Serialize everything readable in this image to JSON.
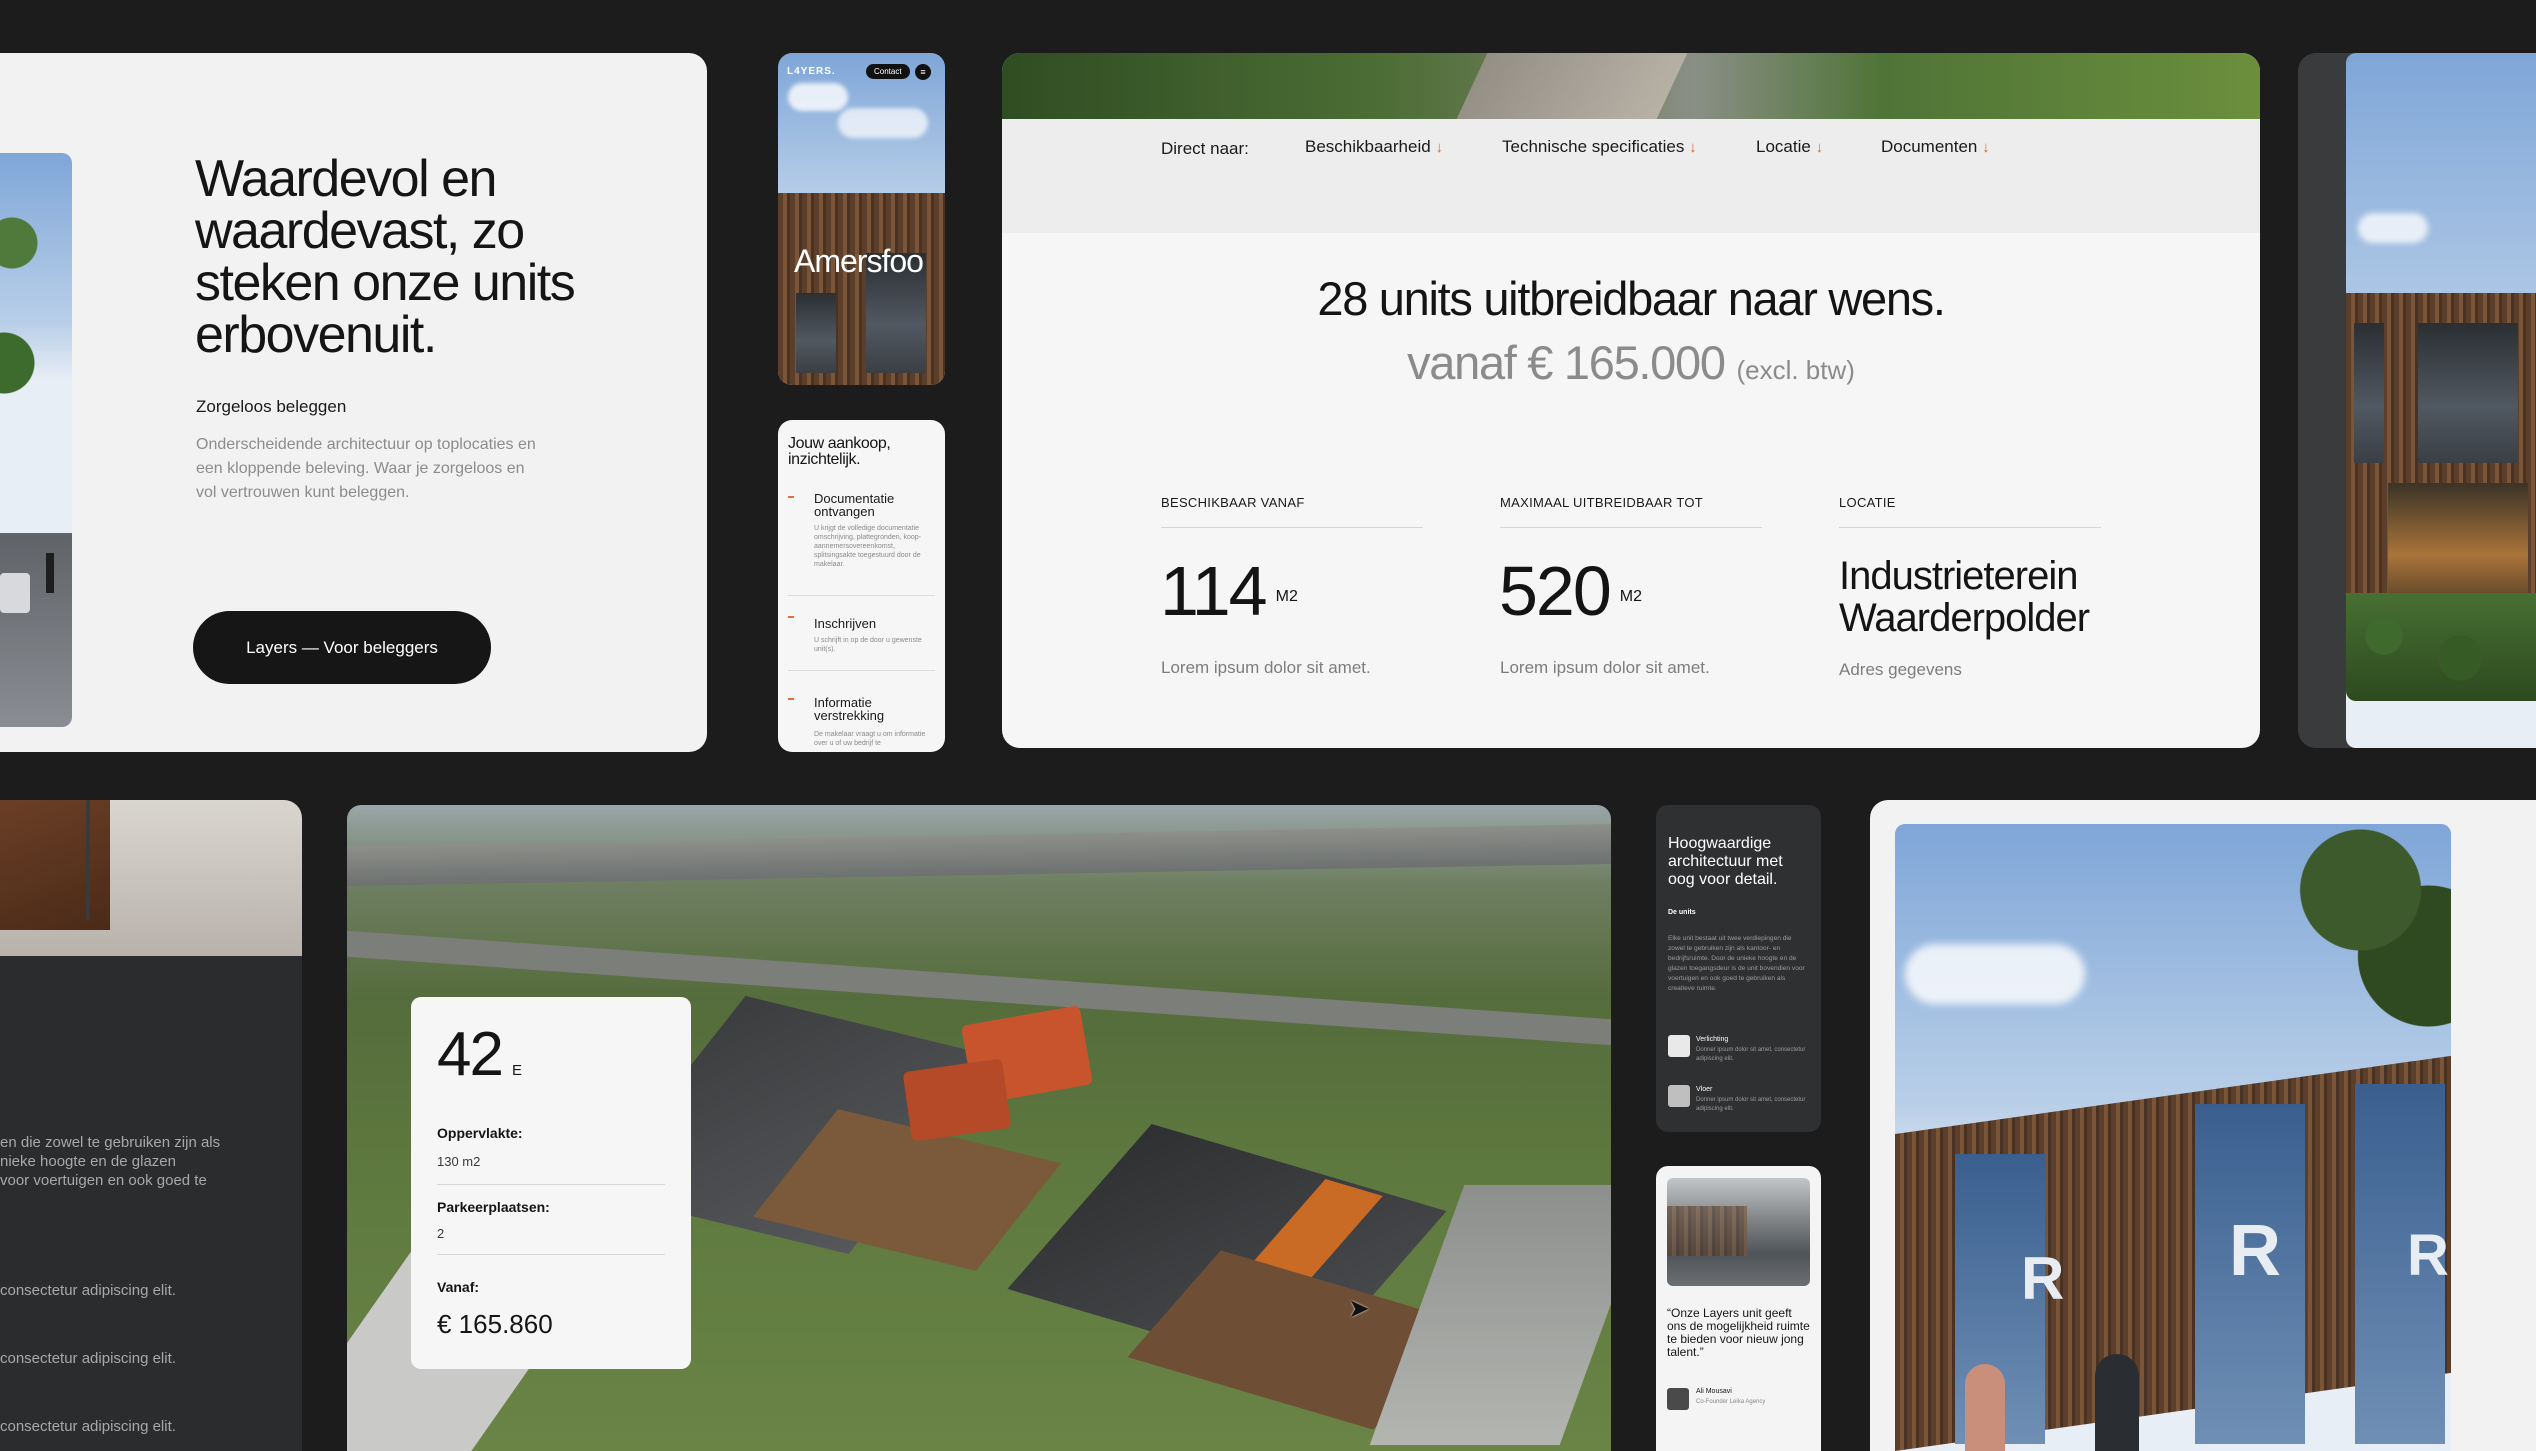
{
  "hero": {
    "title": "Waardevol en waardevast, zo steken onze units erbovenuit.",
    "subtitle": "Zorgeloos beleggen",
    "body": "Onderscheidende architectuur op toplocaties en een kloppende beleving. Waar je zorgeloos en vol vertrouwen kunt beleggen.",
    "button": "Layers — Voor beleggers"
  },
  "mobile_hero": {
    "logo": "L4YERS.",
    "contact": "Contact",
    "city": "Amersfoo"
  },
  "mobile_steps": {
    "title": "Jouw aankoop, inzichtelijk.",
    "steps": [
      {
        "title": "Documentatie ontvangen",
        "text": "U krijgt de volledige documentatie omschrijving, plattegronden, koop-aannemersovereenkomst, splitsingsakte toegestuurd door de makelaar."
      },
      {
        "title": "Inschrijven",
        "text": "U schrijft in op de door u gewenste unit(s)."
      },
      {
        "title": "Informatie verstrekking",
        "text": "De makelaar vraagt u om informatie over u of uw bedrijf te"
      }
    ]
  },
  "info": {
    "nav_prefix": "Direct naar:",
    "nav": [
      "Beschikbaarheid",
      "Technische specificaties",
      "Locatie",
      "Documenten"
    ],
    "nav_arrow": "↓",
    "headline": "28 units uitbreidbaar naar wens.",
    "price": "vanaf € 165.000",
    "price_note": "(excl. btw)",
    "stats": [
      {
        "label": "BESCHIKBAAR VANAF",
        "value": "114",
        "unit": "M2",
        "desc": "Lorem ipsum dolor sit amet."
      },
      {
        "label": "MAXIMAAL UITBREIDBAAR TOT",
        "value": "520",
        "unit": "M2",
        "desc": "Lorem ipsum dolor sit amet."
      }
    ],
    "location": {
      "label": "LOCATIE",
      "name": "Industrieterein Waarderpolder",
      "desc": "Adres gegevens"
    }
  },
  "bottom_left": {
    "lines": [
      "en die zowel te gebruiken zijn als",
      "nieke hoogte en de glazen",
      " voor voertuigen en ook goed te"
    ],
    "items": [
      "consectetur adipiscing elit.",
      "consectetur adipiscing elit.",
      "consectetur adipiscing elit."
    ]
  },
  "unit_card": {
    "number": "42",
    "letter": "E",
    "area_label": "Oppervlakte:",
    "area_value": "130 m2",
    "parking_label": "Parkeerplaatsen:",
    "parking_value": "2",
    "price_label": "Vanaf:",
    "price_value": "€ 165.860"
  },
  "mobile_dark": {
    "title": "Hoogwaardige architectuur met oog voor detail.",
    "section": "De units",
    "text": "Elke unit bestaat uit twee verdiepingen die zowel te gebruiken zijn als kantoor- en bedrijfsruimte. Door de unieke hoogte en de glazen toegangsdeur is de unit bovendien voor voertuigen en ook goed te gebruiken als creatieve ruimte.",
    "features": [
      {
        "title": "Verlichting",
        "text": "Donner ipsum dolor sit amet, consectetur adipiscing elit."
      },
      {
        "title": "Vloer",
        "text": "Donner ipsum dolor sit amet, consectetur adipiscing elit."
      }
    ]
  },
  "mobile_quote": {
    "quote": "“Onze Layers unit geeft ons de mogelijkheid ruimte te bieden voor nieuw jong talent.”",
    "author": "Ali Mousavi",
    "role": "Co-Founder Leika Agency"
  },
  "facade": {
    "signs": [
      "R",
      "R",
      "R"
    ]
  },
  "colors": {
    "accent": "#e36a2c",
    "dark": "#161616",
    "background": "#1c1c1d"
  }
}
